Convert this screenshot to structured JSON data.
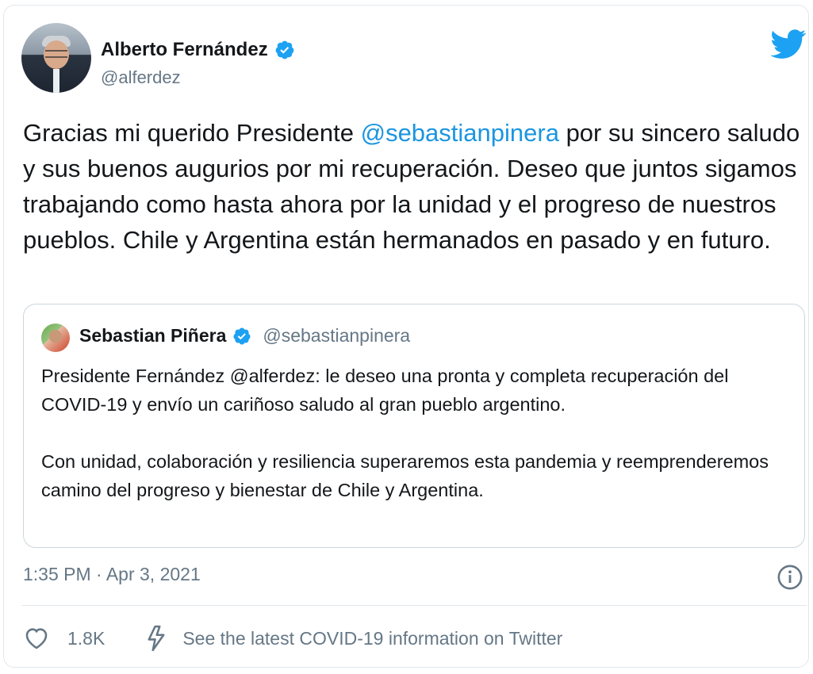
{
  "tweet": {
    "author": {
      "display_name": "Alberto Fernández",
      "handle": "@alferdez",
      "verified": true
    },
    "text_parts": {
      "before": "Gracias mi querido Presidente ",
      "mention": "@sebastianpinera",
      "after": " por su sincero saludo y sus buenos augurios por mi recuperación. Deseo que juntos sigamos trabajando como hasta ahora por la unidad y el progreso de nuestros pueblos. Chile y Argentina están hermanados en pasado y en futuro."
    },
    "quoted": {
      "display_name": "Sebastian Piñera",
      "handle": "@sebastianpinera",
      "verified": true,
      "paragraph1": "Presidente Fernández @alferdez: le deseo una pronta y completa recuperación del COVID-19 y envío un cariñoso saludo al gran pueblo argentino.",
      "paragraph2": "Con unidad, colaboración y resiliencia superaremos esta pandemia y reemprenderemos camino del progreso y bienestar de Chile y Argentina."
    },
    "timestamp": "1:35 PM · Apr 3, 2021",
    "likes": "1.8K",
    "covid_link": "See the latest COVID-19 information on Twitter"
  },
  "colors": {
    "brand": "#1da1f2",
    "mention": "#1b95e0",
    "muted": "#657786",
    "border": "#e1e8ed"
  },
  "icons": [
    "twitter-logo-icon",
    "verified-badge-icon",
    "info-icon",
    "heart-icon",
    "lightning-icon"
  ]
}
